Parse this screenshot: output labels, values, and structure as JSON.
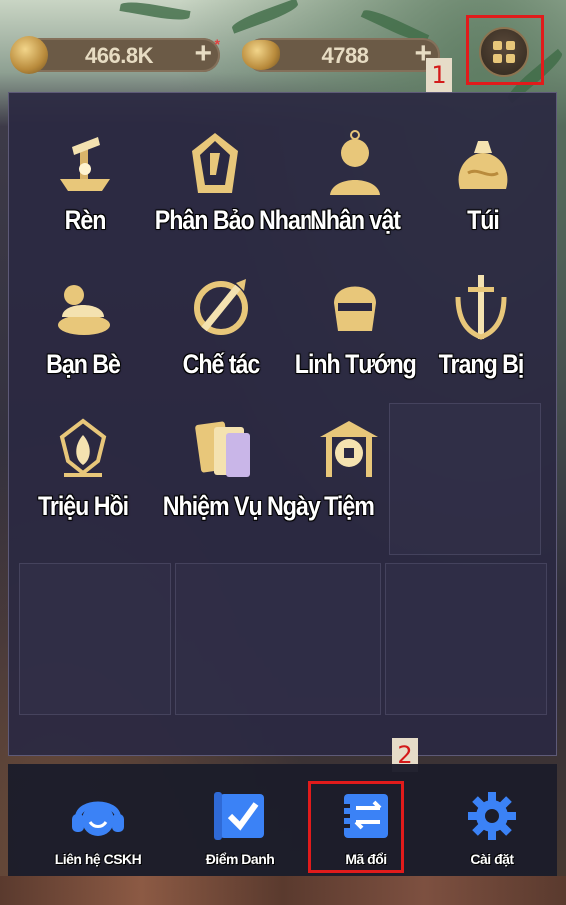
{
  "resources": {
    "coins": {
      "value": "466.8K",
      "plus": "+",
      "icon": "coin-icon"
    },
    "ingots": {
      "value": "4788",
      "plus": "+",
      "icon": "gold-ingot-icon"
    }
  },
  "annotations": {
    "marker_1": "1",
    "marker_2": "2"
  },
  "menu": {
    "items": [
      {
        "label": "Rèn",
        "icon": "forge-icon"
      },
      {
        "label": "Phân Bảo Nham",
        "icon": "gem-stone-icon"
      },
      {
        "label": "Nhân vật",
        "icon": "character-icon"
      },
      {
        "label": "Túi",
        "icon": "bag-icon"
      },
      {
        "label": "Bạn Bè",
        "icon": "friends-icon"
      },
      {
        "label": "Chế tác",
        "icon": "crafting-icon"
      },
      {
        "label": "Linh Tướng",
        "icon": "general-icon"
      },
      {
        "label": "Trang Bị",
        "icon": "equipment-icon"
      },
      {
        "label": "Triệu Hồi",
        "icon": "summon-icon"
      },
      {
        "label": "Nhiệm Vụ Ngày",
        "icon": "daily-quest-icon"
      },
      {
        "label": "Tiệm",
        "icon": "shop-icon"
      }
    ]
  },
  "bottom_bar": {
    "items": [
      {
        "label": "Liên hệ CSKH",
        "icon": "headset-icon"
      },
      {
        "label": "Điểm Danh",
        "icon": "checkin-icon"
      },
      {
        "label": "Mã đổi",
        "icon": "redeem-code-icon"
      },
      {
        "label": "Cài đặt",
        "icon": "gear-icon"
      }
    ]
  },
  "colors": {
    "accent_gold": "#e8c77a",
    "highlight_red": "#e11b1b",
    "bottom_icon_blue": "#3b82f6"
  }
}
